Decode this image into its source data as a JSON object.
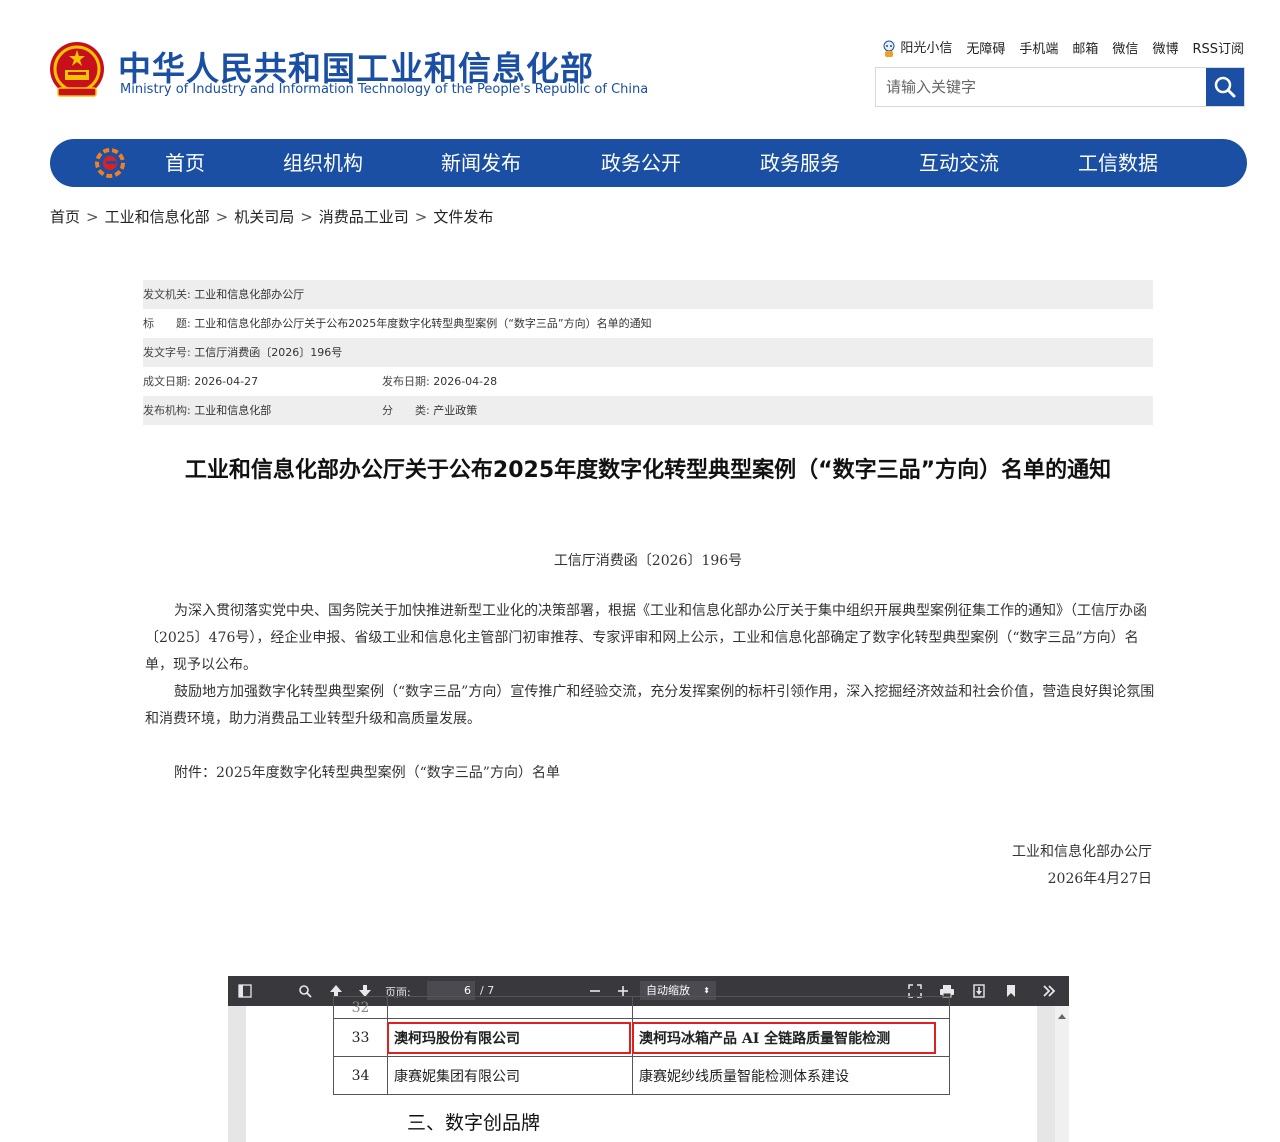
{
  "header": {
    "title": "中华人民共和国工业和信息化部",
    "subtitle": "Ministry of Industry and Information Technology of the People's Republic of China",
    "top_links": [
      "阳光小信",
      "无障碍",
      "手机端",
      "邮箱",
      "微信",
      "微博",
      "RSS订阅"
    ],
    "search_placeholder": "请输入关键字"
  },
  "nav": {
    "items": [
      "首页",
      "组织机构",
      "新闻发布",
      "政务公开",
      "政务服务",
      "互动交流",
      "工信数据"
    ]
  },
  "breadcrumb": [
    "首页",
    "工业和信息化部",
    "机关司局",
    "消费品工业司",
    "文件发布"
  ],
  "meta": {
    "issuer_label": "发文机关:",
    "issuer": "工业和信息化部办公厅",
    "subject_label": "标　　题:",
    "subject": "工业和信息化部办公厅关于公布2025年度数字化转型典型案例（“数字三品”方向）名单的通知",
    "docno_label": "发文字号:",
    "docno": "工信厅消费函〔2026〕196号",
    "created_label": "成文日期:",
    "created": "2026-04-27",
    "published_label": "发布日期:",
    "published": "2026-04-28",
    "org_label": "发布机构:",
    "org": "工业和信息化部",
    "category_label": "分　　类:",
    "category": "产业政策"
  },
  "article": {
    "title": "工业和信息化部办公厅关于公布2025年度数字化转型典型案例（“数字三品”方向）名单的通知",
    "doc_number": "工信厅消费函〔2026〕196号",
    "paragraph1": "为深入贯彻落实党中央、国务院关于加快推进新型工业化的决策部署，根据《工业和信息化部办公厅关于集中组织开展典型案例征集工作的通知》（工信厅办函〔2025〕476号），经企业申报、省级工业和信息化主管部门初审推荐、专家评审和网上公示，工业和信息化部确定了数字化转型典型案例（“数字三品”方向）名单，现予以公布。",
    "paragraph2": "鼓励地方加强数字化转型典型案例（“数字三品”方向）宣传推广和经验交流，充分发挥案例的标杆引领作用，深入挖掘经济效益和社会价值，营造良好舆论氛围和消费环境，助力消费品工业转型升级和高质量发展。",
    "attachment": "附件：2025年度数字化转型典型案例（“数字三品”方向）名单",
    "sign_org": "工业和信息化部办公厅",
    "sign_date": "2026年4月27日"
  },
  "pdf_viewer": {
    "page_label": "页面:",
    "current_page": "6",
    "total_pages": "/ 7",
    "zoom": "自动缩放",
    "rows": [
      {
        "num": "33",
        "company": "澳柯玛股份有限公司",
        "project": "澳柯玛冰箱产品 AI 全链路质量智能检测"
      },
      {
        "num": "34",
        "company": "康赛妮集团有限公司",
        "project": "康赛妮纱线质量智能检测体系建设"
      }
    ],
    "section_heading": "三、数字创品牌",
    "highlight_color": "#e02020"
  }
}
